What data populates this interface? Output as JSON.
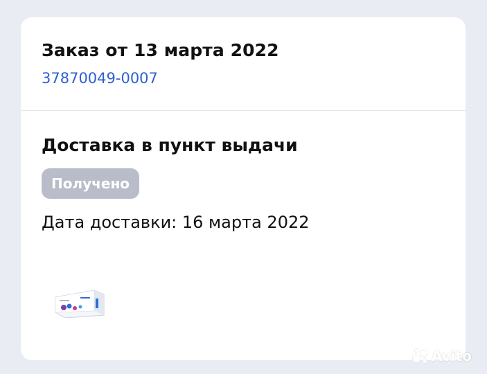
{
  "order": {
    "title": "Заказ от 13 марта 2022",
    "number": "37870049-0007"
  },
  "delivery": {
    "title": "Доставка в пункт выдачи",
    "status": "Получено",
    "date_line": "Дата доставки: 16 марта 2022"
  },
  "product": {
    "thumbnail_icon": "contact-lens-box-image"
  },
  "watermark": {
    "text": "Avito"
  },
  "colors": {
    "background": "#eaecf3",
    "card": "#ffffff",
    "link": "#2f5fd1",
    "badge": "#b8bdc9"
  }
}
